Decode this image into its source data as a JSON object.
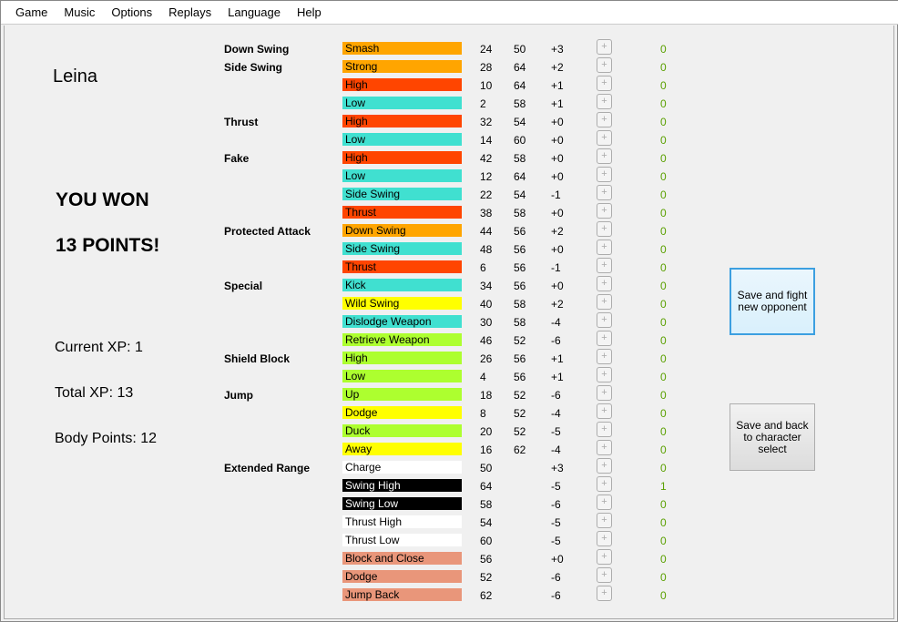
{
  "menu": [
    "Game",
    "Music",
    "Options",
    "Replays",
    "Language",
    "Help"
  ],
  "character_name": "Leina",
  "result_line1": "YOU WON",
  "result_line2": "13 POINTS!",
  "current_xp": "Current XP: 1",
  "total_xp": "Total XP: 13",
  "body_points": "Body Points: 12",
  "buttons": {
    "fight": "Save and fight new opponent",
    "back": "Save and back to character select"
  },
  "colors": {
    "orange": "#ffa500",
    "orangered": "#ff4500",
    "turquoise": "#40e0d0",
    "yellow": "#ffff00",
    "greenyellow": "#adff2f",
    "white": "#ffffff",
    "black": "#000000",
    "salmon": "#e9967a",
    "counter": "#5aa000"
  },
  "moves": [
    {
      "category": "Down Swing",
      "label": "Smash",
      "color": "orange",
      "a": "24",
      "b": "50",
      "mod": "+3",
      "count": "0"
    },
    {
      "category": "Side Swing",
      "label": "Strong",
      "color": "orange",
      "a": "28",
      "b": "64",
      "mod": "+2",
      "count": "0"
    },
    {
      "category": "",
      "label": "High",
      "color": "orangered",
      "a": "10",
      "b": "64",
      "mod": "+1",
      "count": "0"
    },
    {
      "category": "",
      "label": "Low",
      "color": "turquoise",
      "a": "2",
      "b": "58",
      "mod": "+1",
      "count": "0"
    },
    {
      "category": "Thrust",
      "label": "High",
      "color": "orangered",
      "a": "32",
      "b": "54",
      "mod": "+0",
      "count": "0"
    },
    {
      "category": "",
      "label": "Low",
      "color": "turquoise",
      "a": "14",
      "b": "60",
      "mod": "+0",
      "count": "0"
    },
    {
      "category": "Fake",
      "label": "High",
      "color": "orangered",
      "a": "42",
      "b": "58",
      "mod": "+0",
      "count": "0"
    },
    {
      "category": "",
      "label": "Low",
      "color": "turquoise",
      "a": "12",
      "b": "64",
      "mod": "+0",
      "count": "0"
    },
    {
      "category": "",
      "label": "Side Swing",
      "color": "turquoise",
      "a": "22",
      "b": "54",
      "mod": "-1",
      "count": "0"
    },
    {
      "category": "",
      "label": "Thrust",
      "color": "orangered",
      "a": "38",
      "b": "58",
      "mod": "+0",
      "count": "0"
    },
    {
      "category": "Protected Attack",
      "label": "Down Swing",
      "color": "orange",
      "a": "44",
      "b": "56",
      "mod": "+2",
      "count": "0"
    },
    {
      "category": "",
      "label": "Side Swing",
      "color": "turquoise",
      "a": "48",
      "b": "56",
      "mod": "+0",
      "count": "0"
    },
    {
      "category": "",
      "label": "Thrust",
      "color": "orangered",
      "a": "6",
      "b": "56",
      "mod": "-1",
      "count": "0"
    },
    {
      "category": "Special",
      "label": "Kick",
      "color": "turquoise",
      "a": "34",
      "b": "56",
      "mod": "+0",
      "count": "0"
    },
    {
      "category": "",
      "label": "Wild Swing",
      "color": "yellow",
      "a": "40",
      "b": "58",
      "mod": "+2",
      "count": "0"
    },
    {
      "category": "",
      "label": "Dislodge Weapon",
      "color": "turquoise",
      "a": "30",
      "b": "58",
      "mod": "-4",
      "count": "0"
    },
    {
      "category": "",
      "label": "Retrieve Weapon",
      "color": "greenyellow",
      "a": "46",
      "b": "52",
      "mod": "-6",
      "count": "0"
    },
    {
      "category": "Shield Block",
      "label": "High",
      "color": "greenyellow",
      "a": "26",
      "b": "56",
      "mod": "+1",
      "count": "0"
    },
    {
      "category": "",
      "label": "Low",
      "color": "greenyellow",
      "a": "4",
      "b": "56",
      "mod": "+1",
      "count": "0"
    },
    {
      "category": "Jump",
      "label": "Up",
      "color": "greenyellow",
      "a": "18",
      "b": "52",
      "mod": "-6",
      "count": "0"
    },
    {
      "category": "",
      "label": "Dodge",
      "color": "yellow",
      "a": "8",
      "b": "52",
      "mod": "-4",
      "count": "0"
    },
    {
      "category": "",
      "label": "Duck",
      "color": "greenyellow",
      "a": "20",
      "b": "52",
      "mod": "-5",
      "count": "0"
    },
    {
      "category": "",
      "label": "Away",
      "color": "yellow",
      "a": "16",
      "b": "62",
      "mod": "-4",
      "count": "0"
    },
    {
      "category": "Extended Range",
      "label": "Charge",
      "color": "white",
      "a": "50",
      "b": "",
      "mod": "+3",
      "count": "0"
    },
    {
      "category": "",
      "label": "Swing High",
      "color": "black",
      "a": "64",
      "b": "",
      "mod": "-5",
      "count": "1"
    },
    {
      "category": "",
      "label": "Swing Low",
      "color": "black",
      "a": "58",
      "b": "",
      "mod": "-6",
      "count": "0"
    },
    {
      "category": "",
      "label": "Thrust High",
      "color": "white",
      "a": "54",
      "b": "",
      "mod": "-5",
      "count": "0"
    },
    {
      "category": "",
      "label": "Thrust Low",
      "color": "white",
      "a": "60",
      "b": "",
      "mod": "-5",
      "count": "0"
    },
    {
      "category": "",
      "label": "Block and Close",
      "color": "salmon",
      "a": "56",
      "b": "",
      "mod": "+0",
      "count": "0"
    },
    {
      "category": "",
      "label": "Dodge",
      "color": "salmon",
      "a": "52",
      "b": "",
      "mod": "-6",
      "count": "0"
    },
    {
      "category": "",
      "label": "Jump Back",
      "color": "salmon",
      "a": "62",
      "b": "",
      "mod": "-6",
      "count": "0"
    }
  ]
}
